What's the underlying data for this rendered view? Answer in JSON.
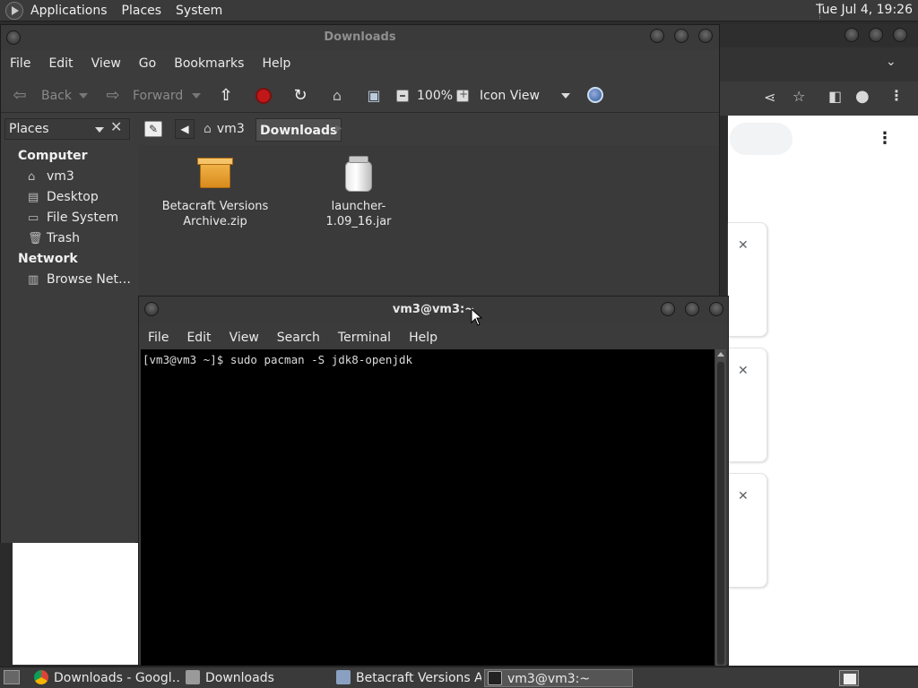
{
  "top_panel": {
    "menus": [
      "Applications",
      "Places",
      "System"
    ],
    "clock": "Tue Jul  4, 19:26"
  },
  "file_manager": {
    "title": "Downloads",
    "menu": [
      "File",
      "Edit",
      "View",
      "Go",
      "Bookmarks",
      "Help"
    ],
    "toolbar": {
      "back_label": "Back",
      "forward_label": "Forward",
      "zoom": "100%",
      "view_mode": "Icon View"
    },
    "sidebar": {
      "header": "Places",
      "sections": [
        {
          "title": "Computer",
          "items": [
            "vm3",
            "Desktop",
            "File System",
            "Trash"
          ]
        },
        {
          "title": "Network",
          "items": [
            "Browse Net…"
          ]
        }
      ]
    },
    "pathbar": {
      "home": "vm3",
      "current": "Downloads"
    },
    "files": [
      {
        "name": "Betacraft Versions Archive.zip",
        "type": "zip"
      },
      {
        "name": "launcher-1.09_16.jar",
        "type": "jar"
      }
    ]
  },
  "terminal": {
    "title": "vm3@vm3:~",
    "menu": [
      "File",
      "Edit",
      "View",
      "Search",
      "Terminal",
      "Help"
    ],
    "line": "[vm3@vm3 ~]$ sudo pacman -S jdk8-openjdk"
  },
  "taskbar": {
    "items": [
      {
        "label": "Downloads - Googl…",
        "icon": "chrome-icon"
      },
      {
        "label": "Downloads",
        "icon": "folder-icon"
      },
      {
        "label": "Betacraft Versions A…",
        "icon": "archive-icon"
      },
      {
        "label": "vm3@vm3:~",
        "icon": "terminal-icon"
      }
    ]
  },
  "icons": {
    "card_close": "✕",
    "chrome_share": "share-icon",
    "chrome_star": "star-icon"
  },
  "colors": {
    "panel_bg": "#3a3a3a",
    "terminal_bg": "#000000",
    "stop_red": "#c01818"
  }
}
